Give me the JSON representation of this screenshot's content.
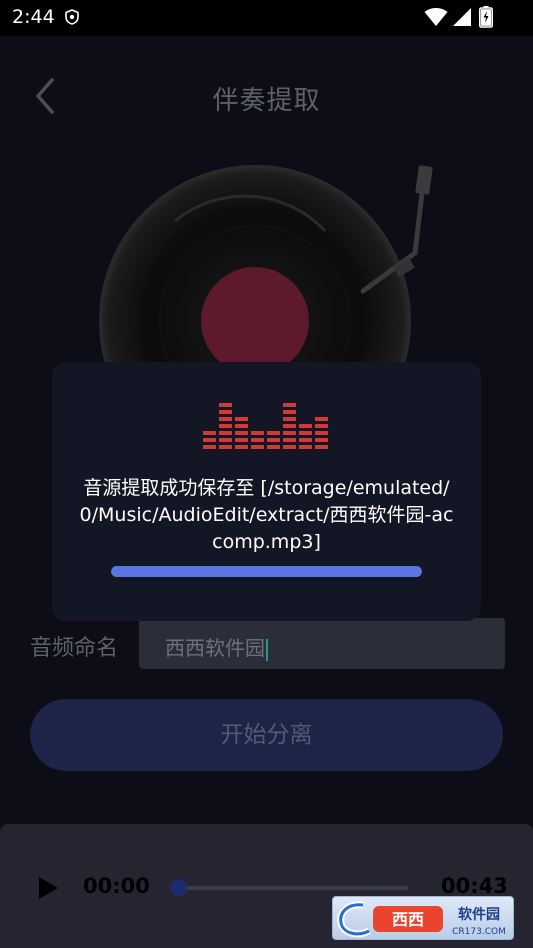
{
  "status_bar": {
    "time": "2:44",
    "icons": [
      "shield-icon",
      "wifi-icon",
      "signal-icon",
      "battery-icon"
    ]
  },
  "header": {
    "back_icon": "back-arrow-icon",
    "title": "伴奏提取"
  },
  "form": {
    "name_label": "音频命名",
    "name_value": "西西软件园",
    "start_button": "开始分离"
  },
  "player": {
    "play_icon": "play-icon",
    "current_time": "00:00",
    "total_time": "00:43",
    "progress": 0
  },
  "dialog": {
    "icon": "equalizer-icon",
    "message": "音源提取成功保存至 [/storage/emulated/0/Music/AudioEdit/extract/西西软件园-accomp.mp3]",
    "progress": 1.0
  },
  "watermark": {
    "text": "西西软件园",
    "domain": "CR173.COM"
  },
  "colors": {
    "background": "#0c0d17",
    "dialog_bg": "#131625",
    "accent": "#5b76e0",
    "equalizer": "#d33a36",
    "record_label": "#5a1a2a"
  }
}
